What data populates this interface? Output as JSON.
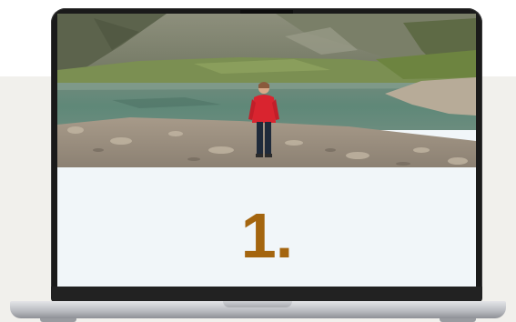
{
  "slide": {
    "step_number": "1.",
    "accent_color": "#a4650f",
    "panel_background": "#f1f6f9"
  },
  "photo": {
    "description_icon": "person-at-alpine-lake-photo"
  },
  "device": {
    "type_icon": "laptop-icon",
    "bezel_color": "#1a1a1a"
  }
}
